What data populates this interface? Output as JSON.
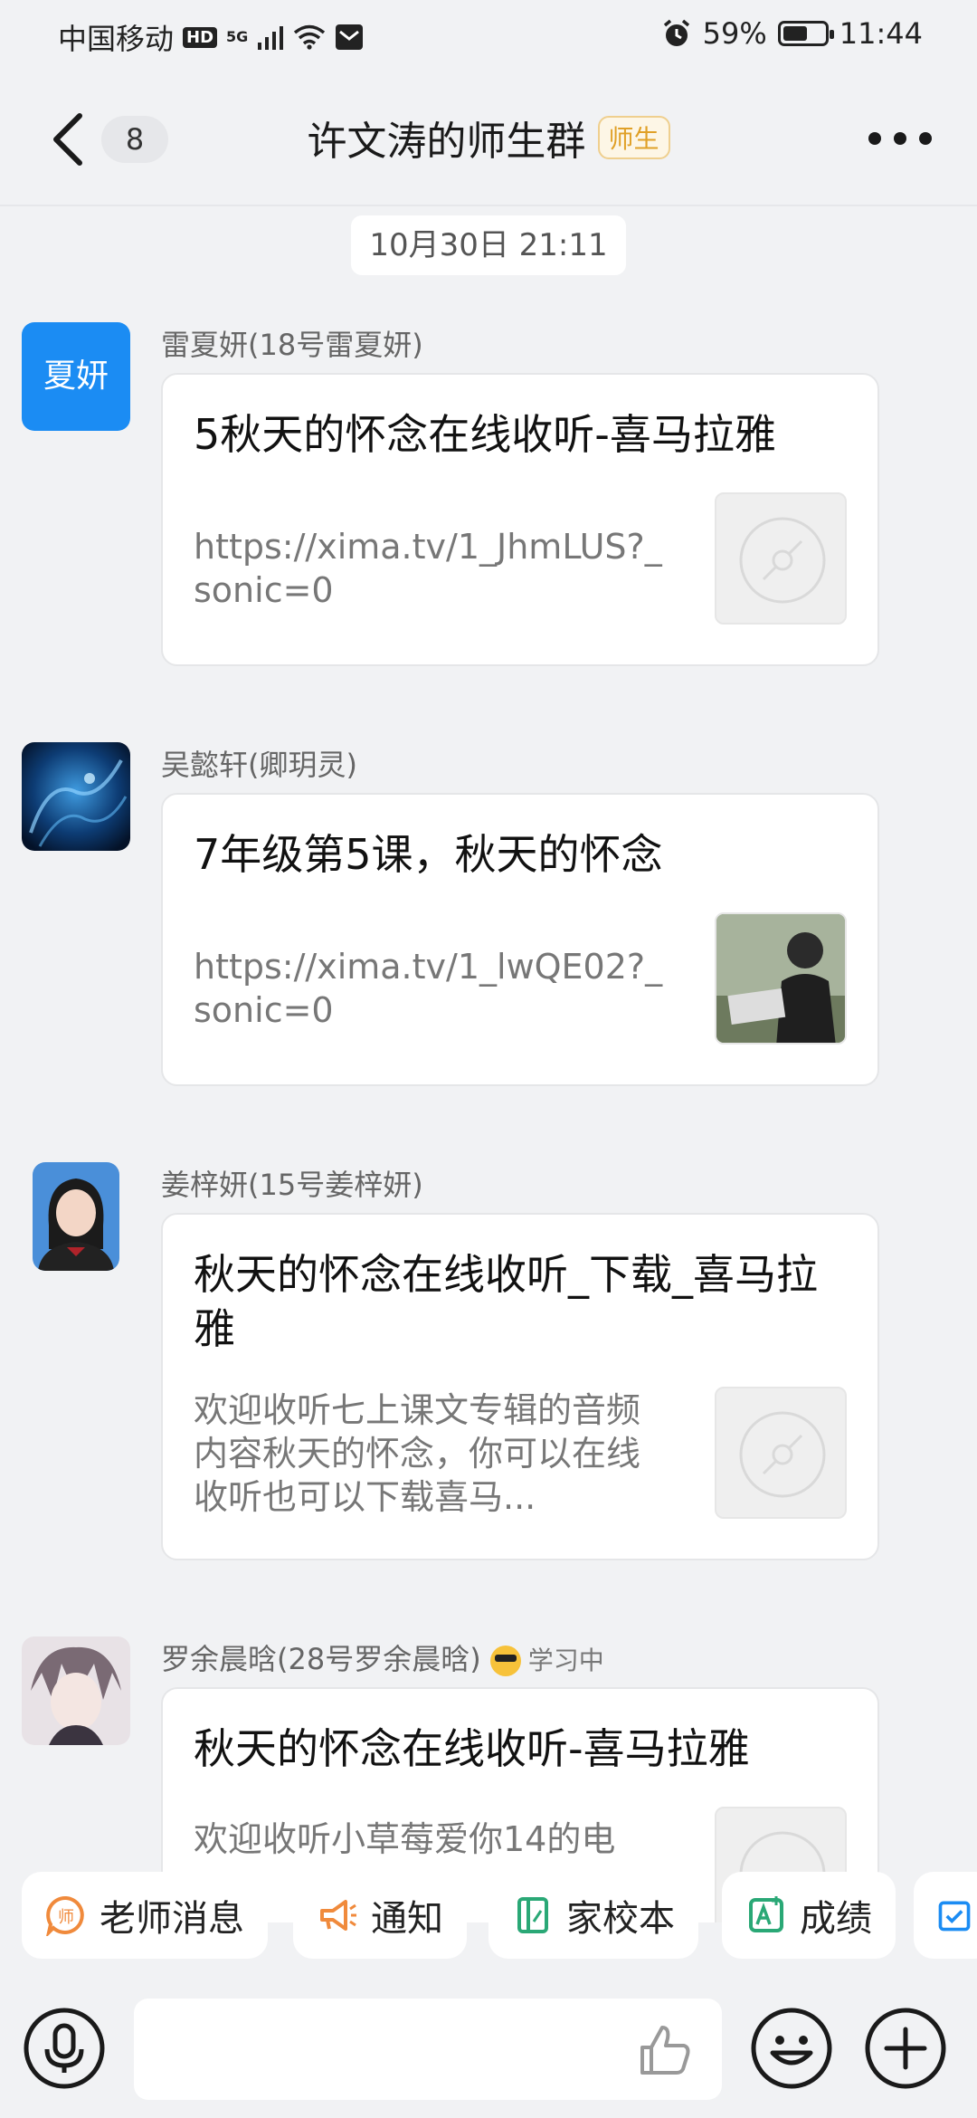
{
  "status_bar": {
    "carrier": "中国移动",
    "hd": "HD",
    "net": "5G",
    "battery": "59%",
    "battery_level": 0.59,
    "time": "11:44"
  },
  "header": {
    "count": "8",
    "title": "许文涛的师生群",
    "tag": "师生"
  },
  "timestamp": "10月30日 21:11",
  "messages": [
    {
      "avatar_text": "夏妍",
      "sender": "雷夏妍(18号雷夏妍)",
      "title": "5秋天的怀念在线收听-喜马拉雅",
      "desc": "https://xima.tv/1_JhmLUS?_sonic=0"
    },
    {
      "sender": "吴懿轩(卿玥灵)",
      "title": "7年级第5课，秋天的怀念",
      "desc": "https://xima.tv/1_lwQE02?_sonic=0"
    },
    {
      "sender": "姜梓妍(15号姜梓妍)",
      "title": "秋天的怀念在线收听_下载_喜马拉雅",
      "desc": "欢迎收听七上课文专辑的音频内容秋天的怀念，你可以在线收听也可以下载喜马..."
    },
    {
      "sender": "罗余晨晗(28号罗余晨晗)",
      "status": "学习中",
      "title": "秋天的怀念在线收听-喜马拉雅",
      "desc": "欢迎收听小草莓爱你14的电"
    }
  ],
  "quick_actions": [
    {
      "label": "老师消息",
      "icon": "teacher-message-icon",
      "color": "#f08a3c"
    },
    {
      "label": "通知",
      "icon": "megaphone-icon",
      "color": "#f08a3c"
    },
    {
      "label": "家校本",
      "icon": "notebook-icon",
      "color": "#2aa876"
    },
    {
      "label": "成绩",
      "icon": "grade-icon",
      "color": "#2aa876"
    }
  ],
  "colors": {
    "background": "#f1f2f4",
    "avatar_blue": "#1b8cf3",
    "tag_orange": "#e0a027"
  }
}
